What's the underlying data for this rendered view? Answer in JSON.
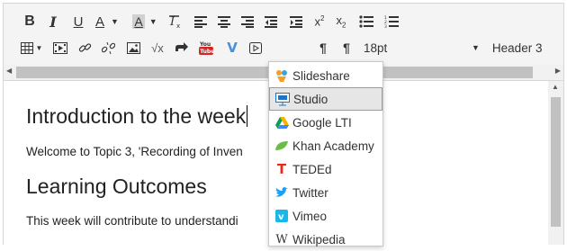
{
  "toolbar": {
    "row1": [
      {
        "name": "bold-button",
        "glyph": "B"
      },
      {
        "name": "italic-button",
        "glyph": "I"
      },
      {
        "name": "underline-button",
        "glyph": "U"
      },
      {
        "name": "font-color-button",
        "glyph": "A"
      },
      {
        "name": "background-color-button",
        "glyph": "A"
      },
      {
        "name": "clear-formatting-button",
        "glyph": "Ix"
      },
      {
        "name": "align-left-button",
        "icon": "align-left-icon"
      },
      {
        "name": "align-center-button",
        "icon": "align-center-icon"
      },
      {
        "name": "align-right-button",
        "icon": "align-right-icon"
      },
      {
        "name": "outdent-button",
        "icon": "outdent-icon"
      },
      {
        "name": "indent-button",
        "icon": "indent-icon"
      },
      {
        "name": "superscript-button",
        "glyph": "x²"
      },
      {
        "name": "subscript-button",
        "glyph": "x₂"
      },
      {
        "name": "bullet-list-button",
        "icon": "bullet-list-icon"
      },
      {
        "name": "numbered-list-button",
        "icon": "numbered-list-icon"
      }
    ],
    "row2": [
      {
        "name": "table-button",
        "icon": "table-icon"
      },
      {
        "name": "media-button",
        "icon": "film-icon"
      },
      {
        "name": "link-button",
        "icon": "link-icon"
      },
      {
        "name": "unlink-button",
        "icon": "unlink-icon"
      },
      {
        "name": "image-button",
        "icon": "image-icon"
      },
      {
        "name": "equation-button",
        "icon": "sqrt-icon"
      },
      {
        "name": "redirect-button",
        "icon": "redirect-icon"
      },
      {
        "name": "youtube-button",
        "icon": "youtube-icon"
      },
      {
        "name": "embed-menu-button",
        "icon": "v-icon"
      },
      {
        "name": "video-button",
        "icon": "play-box-icon"
      },
      {
        "name": "ltr-button",
        "icon": "ltr-icon"
      },
      {
        "name": "rtl-button",
        "icon": "rtl-icon"
      }
    ],
    "font_size": "18pt",
    "block_format": "Header 3",
    "accent_color": "#1e88e5"
  },
  "editor": {
    "heading1": "Introduction to the week",
    "para1": "Welcome to Topic 3, 'Recording of Inven",
    "heading2": "Learning Outcomes",
    "para2": "This week will contribute to understandi"
  },
  "embed_menu": {
    "items": [
      {
        "label": "Slideshare",
        "icon": "slideshare-icon",
        "color": "#f4a024"
      },
      {
        "label": "Studio",
        "icon": "studio-icon",
        "color": "#1e74c8",
        "active": true
      },
      {
        "label": "Google LTI",
        "icon": "google-drive-icon",
        "color": "#0f9d58"
      },
      {
        "label": "Khan Academy",
        "icon": "khan-academy-icon",
        "color": "#6cbd45"
      },
      {
        "label": "TEDEd",
        "icon": "tedEd-icon",
        "color": "#e62b1e"
      },
      {
        "label": "Twitter",
        "icon": "twitter-icon",
        "color": "#1da1f2"
      },
      {
        "label": "Vimeo",
        "icon": "vimeo-icon",
        "color": "#1ab7ea"
      },
      {
        "label": "Wikipedia",
        "icon": "wikipedia-icon",
        "color": "#333333"
      }
    ]
  }
}
